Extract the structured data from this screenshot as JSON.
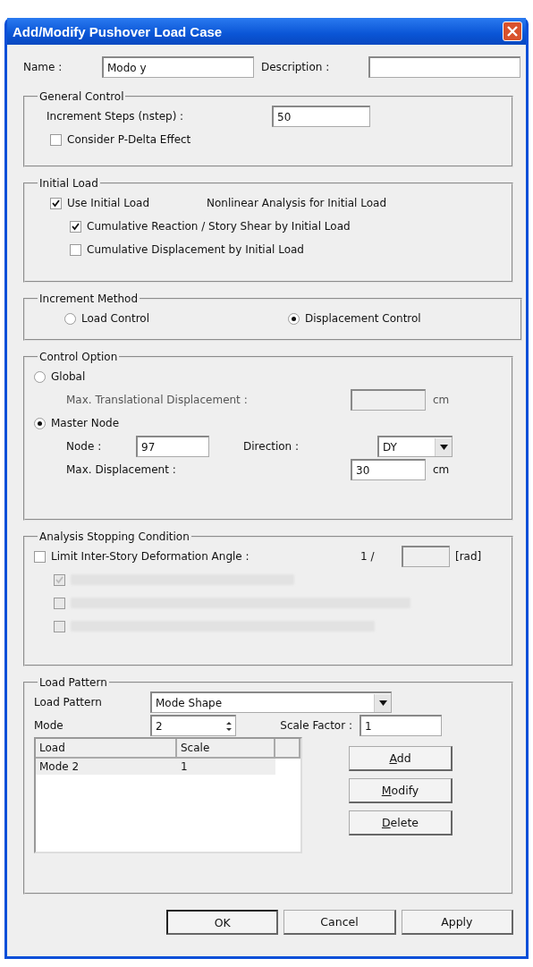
{
  "window": {
    "title": "Add/Modify Pushover Load Case"
  },
  "name": {
    "label": "Name :",
    "value": "Modo y"
  },
  "description": {
    "label": "Description :"
  },
  "general_control": {
    "title": "General Control",
    "increment_steps": {
      "label": "Increment Steps (nstep) :",
      "value": "50"
    },
    "p_delta": {
      "label": "Consider P-Delta Effect",
      "checked": false
    }
  },
  "initial_load": {
    "title": "Initial Load",
    "use_initial_load": {
      "label": "Use Initial Load",
      "checked": true
    },
    "initial_load_case": "Nonlinear Analysis for Initial Load",
    "options": [
      {
        "label": "Cumulative Reaction / Story Shear by Initial Load",
        "checked": true
      },
      {
        "label": "Cumulative Displacement by Initial Load",
        "checked": false
      }
    ]
  },
  "increment_method": {
    "title": "Increment Method",
    "options": [
      {
        "label": "Load Control",
        "selected": false
      },
      {
        "label": "Displacement Control",
        "selected": true
      }
    ]
  },
  "control_option": {
    "title": "Control Option",
    "modes": [
      {
        "label": "Global",
        "selected": false
      },
      {
        "label": "Master Node",
        "selected": true
      }
    ],
    "max_translational": {
      "label": "Max. Translational Displacement :",
      "unit": "cm",
      "disabled": true
    },
    "node": {
      "label": "Node :",
      "value": "97"
    },
    "direction": {
      "label": "Direction :",
      "value": "DY"
    },
    "max_displacement": {
      "label": "Max. Displacement :",
      "value": "30",
      "unit": "cm"
    }
  },
  "stopping": {
    "title": "Analysis Stopping Condition",
    "limit": {
      "label": "Limit Inter-Story Deformation Angle :",
      "checked": false,
      "prefix": "1 /",
      "unit": "[rad]"
    },
    "sub_options": [
      {
        "checked": true,
        "disabled": true
      },
      {
        "checked": false,
        "disabled": true
      },
      {
        "checked": false,
        "disabled": true
      }
    ]
  },
  "load_pattern": {
    "title": "Load Pattern",
    "pattern": {
      "label": "Load Pattern",
      "value": "Mode Shape"
    },
    "mode": {
      "label": "Mode",
      "value": "2"
    },
    "scale_factor": {
      "label": "Scale Factor :",
      "value": "1"
    },
    "table": {
      "columns": [
        "Load",
        "Scale"
      ],
      "rows": [
        [
          "Mode 2",
          "1"
        ]
      ]
    },
    "side_buttons": [
      {
        "label": "Add",
        "mnemonic": true
      },
      {
        "label": "Modify",
        "mnemonic": true
      },
      {
        "label": "Delete",
        "mnemonic": true
      }
    ]
  },
  "buttons": [
    {
      "label": "OK",
      "default": true
    },
    {
      "label": "Cancel",
      "default": false
    },
    {
      "label": "Apply",
      "default": false
    }
  ]
}
